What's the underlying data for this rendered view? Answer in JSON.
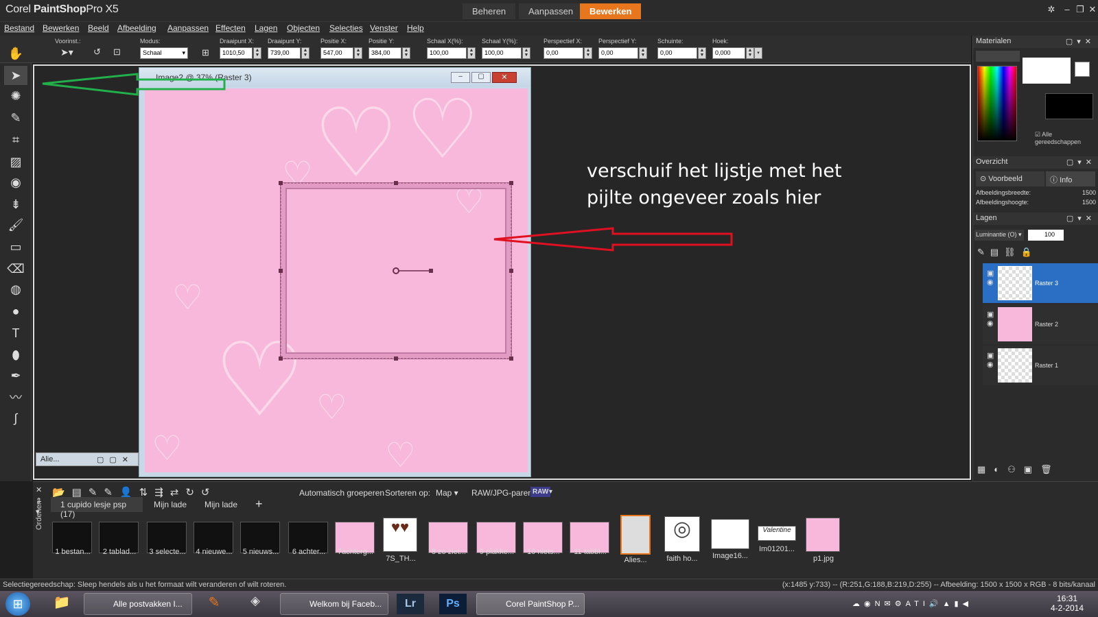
{
  "app": {
    "title_part1": "Corel",
    "title_part2": "PaintShop",
    "title_part3": "Pro X5",
    "workspace_tabs": [
      "Beheren",
      "Aanpassen",
      "Bewerken"
    ],
    "active_tab": "Bewerken"
  },
  "menu": [
    "Bestand",
    "Bewerken",
    "Beeld",
    "Afbeelding",
    "Aanpassen",
    "Effecten",
    "Lagen",
    "Objecten",
    "Selecties",
    "Venster",
    "Help"
  ],
  "toolbar": {
    "preset_label": "Voorinst.:",
    "mode_label": "Modus:",
    "mode_value": "Schaal",
    "pivot_x_label": "Draaipunt X:",
    "pivot_x": "1010,50",
    "pivot_y_label": "Draaipunt Y:",
    "pivot_y": "739,00",
    "pos_x_label": "Positie X:",
    "pos_x": "547,00",
    "pos_y_label": "Positie Y:",
    "pos_y": "384,00",
    "scale_x_label": "Schaal X(%):",
    "scale_x": "100,00",
    "scale_y_label": "Schaal Y(%):",
    "scale_y": "100,00",
    "persp_x_label": "Perspectief X:",
    "persp_x": "0,00",
    "persp_y_label": "Perspectief Y:",
    "persp_y": "0,00",
    "skew_label": "Schuinte:",
    "skew": "0,00",
    "angle_label": "Hoek:",
    "angle": "0,000"
  },
  "document": {
    "title": "Image2 @ 37% (Raster 3)",
    "minimized_title": "Alie..."
  },
  "annotation": {
    "line1": "verschuif het lijstje met het",
    "line2": "pijlte ongeveer zoals hier",
    "red_arrow_color": "#e01020",
    "green_arrow_color": "#22b04a"
  },
  "materials": {
    "title": "Materialen",
    "all_tools": "Alle gereedschappen"
  },
  "overview": {
    "title": "Overzicht",
    "tab_preview": "Voorbeeld",
    "tab_info": "Info",
    "width_label": "Afbeeldingsbreedte:",
    "width_value": "1500",
    "height_label": "Afbeeldingshoogte:",
    "height_value": "1500"
  },
  "layers": {
    "title": "Lagen",
    "blend_mode": "Luminantie (O)",
    "opacity": "100",
    "items": [
      "Raster 3",
      "Raster 2",
      "Raster 1"
    ],
    "selected": "Raster 3"
  },
  "organizer": {
    "auto_group": "Automatisch groeperen",
    "sort_label": "Sorteren op:",
    "sort_value": "Map",
    "raw_label": "RAW/JPG-paren:",
    "raw_badge": "RAW",
    "side_label": "Ordenen",
    "tabs": [
      "1 cupido lesje psp (17)",
      "Mijn lade",
      "Mijn lade"
    ],
    "thumbs": [
      "1 bestan...",
      "2 tablad...",
      "3 selecte...",
      "4 nieuwe...",
      "5 nieuws...",
      "6 achter...",
      "7achterg...",
      "7S_TH...",
      "8 zo ziet...",
      "9 plakke...",
      "10 niets...",
      "11 tabbl...",
      "Alies...",
      "faith ho...",
      "Image16...",
      "Im01201...",
      "p1.jpg"
    ]
  },
  "status": {
    "left": "Selectiegereedschap: Sleep hendels als u het formaat wilt veranderen of wilt roteren.",
    "right": "(x:1485 y:733) -- (R:251,G:188,B:219,D:255) -- Afbeelding:  1500 x 1500 x RGB - 8 bits/kanaal"
  },
  "taskbar": {
    "items": [
      "Alle postvakken I...",
      "Welkom bij Faceb...",
      "Corel PaintShop P..."
    ],
    "time": "16:31",
    "date": "4-2-2014"
  }
}
